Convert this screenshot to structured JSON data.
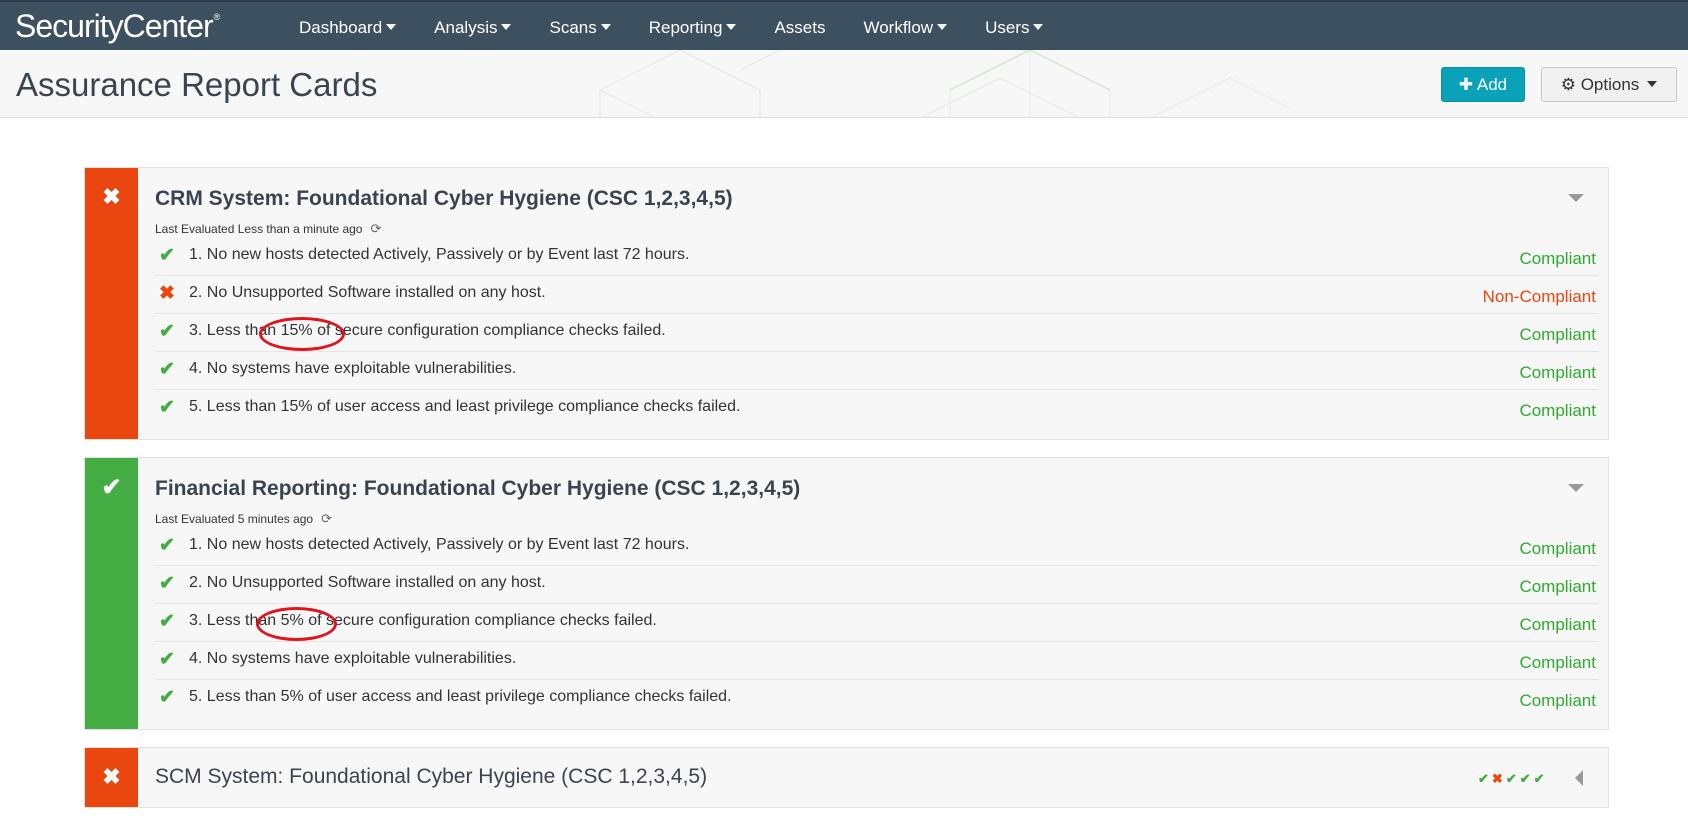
{
  "app": {
    "brand": "SecurityCenter",
    "brand_mark": "®"
  },
  "nav": [
    {
      "label": "Dashboard",
      "has_menu": true
    },
    {
      "label": "Analysis",
      "has_menu": true
    },
    {
      "label": "Scans",
      "has_menu": true
    },
    {
      "label": "Reporting",
      "has_menu": true
    },
    {
      "label": "Assets",
      "has_menu": false
    },
    {
      "label": "Workflow",
      "has_menu": true
    },
    {
      "label": "Users",
      "has_menu": true
    }
  ],
  "header": {
    "title": "Assurance Report Cards",
    "add_label": "Add",
    "options_label": "Options"
  },
  "cards": [
    {
      "title": "CRM System: Foundational Cyber Hygiene (CSC 1,2,3,4,5)",
      "status": "fail",
      "last_evaluated": "Last Evaluated Less than a minute ago",
      "rows": [
        {
          "text": "1. No new hosts detected Actively, Passively or by Event last 72 hours.",
          "status": "Compliant",
          "ok": true
        },
        {
          "text": "2. No Unsupported Software installed on any host.",
          "status": "Non-Compliant",
          "ok": false
        },
        {
          "text": "3. Less than 15% of secure configuration compliance checks failed.",
          "status": "Compliant",
          "ok": true
        },
        {
          "text": "4. No systems have exploitable vulnerabilities.",
          "status": "Compliant",
          "ok": true
        },
        {
          "text": "5. Less than 15% of user access and least privilege compliance checks failed.",
          "status": "Compliant",
          "ok": true
        }
      ]
    },
    {
      "title": "Financial Reporting: Foundational Cyber Hygiene (CSC 1,2,3,4,5)",
      "status": "pass",
      "last_evaluated": "Last Evaluated 5 minutes ago",
      "rows": [
        {
          "text": "1. No new hosts detected Actively, Passively or by Event last 72 hours.",
          "status": "Compliant",
          "ok": true
        },
        {
          "text": "2. No Unsupported Software installed on any host.",
          "status": "Compliant",
          "ok": true
        },
        {
          "text": "3. Less than 5% of secure configuration compliance checks failed.",
          "status": "Compliant",
          "ok": true
        },
        {
          "text": "4. No systems have exploitable vulnerabilities.",
          "status": "Compliant",
          "ok": true
        },
        {
          "text": "5. Less than 5% of user access and least privilege compliance checks failed.",
          "status": "Compliant",
          "ok": true
        }
      ]
    },
    {
      "title": "SCM System: Foundational Cyber Hygiene (CSC 1,2,3,4,5)",
      "status": "fail",
      "collapsed": true,
      "summary": [
        "✔",
        "✖",
        "✔",
        "✔",
        "✔"
      ]
    }
  ],
  "icons": {
    "check": "✔",
    "cross": "✖",
    "refresh": "⟳",
    "plus": "✚",
    "gear": "⚙"
  },
  "colors": {
    "nav_bg": "#3d5060",
    "fail": "#e9470f",
    "pass": "#43ac43",
    "add_button": "#0aa2b8",
    "annotation": "#e0141e"
  }
}
